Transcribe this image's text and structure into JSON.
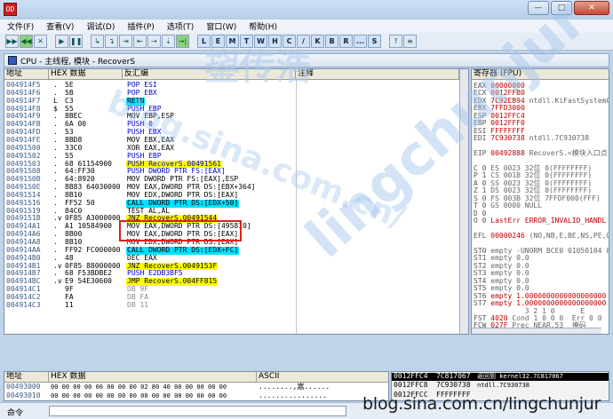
{
  "window": {
    "app_icon": "OD",
    "minimize": "—",
    "maximize": "□",
    "close": "✕"
  },
  "menu": [
    "文件(F)",
    "查看(V)",
    "调试(D)",
    "插件(P)",
    "选项(T)",
    "窗口(W)",
    "帮助(H)"
  ],
  "toolbar": {
    "run_buttons": [
      "▶▶",
      "◀◀",
      "✕",
      "▶",
      "❚❚",
      "↳",
      "↴",
      "⇥",
      "⇤",
      "⇢",
      "⇣",
      "→|"
    ],
    "letters": [
      "L",
      "E",
      "M",
      "T",
      "W",
      "H",
      "C",
      "/",
      "K",
      "B",
      "R",
      "...",
      "S"
    ],
    "extra": [
      "?",
      "≡"
    ]
  },
  "cpu_window": {
    "title": "CPU - 主线程, 模块 - RecoverS"
  },
  "disasm": {
    "headers": {
      "addr": "地址",
      "hex": "HEX 数据",
      "dis": "反汇编",
      "comment": "注释"
    },
    "rows": [
      {
        "addr": "004914F5",
        "mark": ".",
        "hex": "5E",
        "dis": "POP ESI",
        "style": "blue"
      },
      {
        "addr": "004914F6",
        "mark": ".",
        "hex": "5B",
        "dis": "POP EBX",
        "style": "blue"
      },
      {
        "addr": "004914F7",
        "mark": "L",
        "hex": "C3",
        "dis": "RETN",
        "style": "cyan"
      },
      {
        "addr": "004914F8",
        "mark": "$",
        "hex": "55",
        "dis": "PUSH EBP",
        "style": "blue"
      },
      {
        "addr": "004914F9",
        "mark": ".",
        "hex": "8BEC",
        "dis": "MOV EBP,ESP",
        "style": ""
      },
      {
        "addr": "004914FB",
        "mark": ".",
        "hex": "6A 00",
        "dis": "PUSH 0",
        "style": "blue"
      },
      {
        "addr": "004914FD",
        "mark": ".",
        "hex": "53",
        "dis": "PUSH EBX",
        "style": "blue"
      },
      {
        "addr": "004914FE",
        "mark": ".",
        "hex": "8BD8",
        "dis": "MOV EBX,EAX",
        "style": ""
      },
      {
        "addr": "00491500",
        "mark": ".",
        "hex": "33C0",
        "dis": "XOR EAX,EAX",
        "style": ""
      },
      {
        "addr": "00491502",
        "mark": ".",
        "hex": "55",
        "dis": "PUSH EBP",
        "style": "blue"
      },
      {
        "addr": "00491503",
        "mark": ".",
        "hex": "68 61154900",
        "dis": "PUSH RecoverS.00491561",
        "style": "blue-y"
      },
      {
        "addr": "00491508",
        "mark": ".",
        "hex": "64:FF30",
        "dis": "PUSH DWORD PTR FS:[EAX]",
        "style": "blue"
      },
      {
        "addr": "0049150B",
        "mark": ".",
        "hex": "64:8920",
        "dis": "MOV DWORD PTR FS:[EAX],ESP",
        "style": ""
      },
      {
        "addr": "0049150E",
        "mark": ".",
        "hex": "8B83 64030000",
        "dis": "MOV EAX,DWORD PTR DS:[EBX+364]",
        "style": ""
      },
      {
        "addr": "00491514",
        "mark": ".",
        "hex": "8B10",
        "dis": "MOV EDX,DWORD PTR DS:[EAX]",
        "style": ""
      },
      {
        "addr": "00491516",
        "mark": ".",
        "hex": "FF52 50",
        "dis": "CALL DWORD PTR DS:[EDX+50]",
        "style": "cyan"
      },
      {
        "addr": "00491519",
        "mark": ".",
        "hex": "84C0",
        "dis": "TEST AL,AL",
        "style": ""
      },
      {
        "addr": "0049151B",
        "mark": ".v",
        "hex": "0F85 A3000000",
        "dis": "JNZ RecoverS.00491544",
        "style": "yellow"
      },
      {
        "addr": "004914A1",
        "mark": ".",
        "hex": "A1 10584900",
        "dis": "MOV EAX,DWORD PTR DS:[495810]",
        "style": ""
      },
      {
        "addr": "004914A6",
        "mark": ".",
        "hex": "8B00",
        "dis": "MOV EAX,DWORD PTR DS:[EAX]",
        "style": ""
      },
      {
        "addr": "004914A8",
        "mark": ".",
        "hex": "8B10",
        "dis": "MOV EDX,DWORD PTR DS:[EAX]",
        "style": ""
      },
      {
        "addr": "004914AA",
        "mark": ".",
        "hex": "FF92 FC000000",
        "dis": "CALL DWORD PTR DS:[EDX+FC]",
        "style": "cyan"
      },
      {
        "addr": "004914B0",
        "mark": ".",
        "hex": "48",
        "dis": "DEC EAX",
        "style": ""
      },
      {
        "addr": "004914B1",
        "mark": ".v",
        "hex": "0F85 88000000",
        "dis": "JNZ RecoverS.0049153F",
        "style": "yellow"
      },
      {
        "addr": "004914B7",
        "mark": ".",
        "hex": "68 F53BDBE2",
        "dis": "PUSH E2DB3BF5",
        "style": "blue"
      },
      {
        "addr": "004914BC",
        "mark": ".v",
        "hex": "E9 54E30600",
        "dis": "JMP RecoverS.004FF815",
        "style": "yellow"
      },
      {
        "addr": "004914C1",
        "mark": "",
        "hex": "9F",
        "dis": "DB 9F",
        "style": "grey"
      },
      {
        "addr": "004914C2",
        "mark": "",
        "hex": "FA",
        "dis": "DB FA",
        "style": "grey"
      },
      {
        "addr": "004914C3",
        "mark": "",
        "hex": "11",
        "dis": "DB 11",
        "style": "grey"
      }
    ]
  },
  "registers": {
    "header": "寄存器 (FPU)",
    "lines": [
      {
        "name": "EAX",
        "value": "00000000",
        "note": ""
      },
      {
        "name": "ECX",
        "value": "0012FFB0",
        "note": ""
      },
      {
        "name": "EDX",
        "value": "7C92EB94",
        "note": "ntdll.KiFastSystemC"
      },
      {
        "name": "EBX",
        "value": "7FFD3000",
        "note": ""
      },
      {
        "name": "ESP",
        "value": "0012FFC4",
        "note": ""
      },
      {
        "name": "EBP",
        "value": "0012FFF0",
        "note": ""
      },
      {
        "name": "ESI",
        "value": "FFFFFFFF",
        "note": ""
      },
      {
        "name": "EDI",
        "value": "7C930738",
        "note": "ntdll.7C930738"
      },
      {
        "name": "",
        "value": "",
        "note": ""
      },
      {
        "name": "EIP",
        "value": "00492888",
        "note": "RecoverS.<模块入口点"
      },
      {
        "name": "",
        "value": "",
        "note": ""
      },
      {
        "name": "C 0",
        "value": "",
        "note": "ES 0023 32位 0(FFFFFFFF)"
      },
      {
        "name": "P 1",
        "value": "",
        "note": "CS 001B 32位 0(FFFFFFFF)"
      },
      {
        "name": "A 0",
        "value": "",
        "note": "SS 0023 32位 0(FFFFFFFF)"
      },
      {
        "name": "Z 1",
        "value": "",
        "note": "DS 0023 32位 0(FFFFFFFF)"
      },
      {
        "name": "S 0",
        "value": "",
        "note": "FS 003B 32位 7FFDF000(FFF)"
      },
      {
        "name": "T 0",
        "value": "",
        "note": "GS 0000 NULL"
      },
      {
        "name": "D 0",
        "value": "",
        "note": ""
      },
      {
        "name": "O 0",
        "value": "",
        "note": "LastErr ERROR_INVALID_HANDL"
      },
      {
        "name": "",
        "value": "",
        "note": ""
      },
      {
        "name": "EFL",
        "value": "00000246",
        "note": "(NO,NB,E,BE,NS,PE,GE"
      },
      {
        "name": "",
        "value": "",
        "note": ""
      },
      {
        "name": "ST0",
        "value": "",
        "note": "empty -UNORM BCE0 01050104 0"
      },
      {
        "name": "ST1",
        "value": "",
        "note": "empty 0.0"
      },
      {
        "name": "ST2",
        "value": "",
        "note": "empty 0.0"
      },
      {
        "name": "ST3",
        "value": "",
        "note": "empty 0.0"
      },
      {
        "name": "ST4",
        "value": "",
        "note": "empty 0.0"
      },
      {
        "name": "ST5",
        "value": "",
        "note": "empty 0.0"
      },
      {
        "name": "ST6",
        "value": "",
        "note": "empty 1.0000000000000000000"
      },
      {
        "name": "ST7",
        "value": "",
        "note": "empty 1.0000000000000000000"
      },
      {
        "name": "",
        "value": "",
        "note": "            3 2 1 0      E"
      },
      {
        "name": "FST",
        "value": "4020",
        "note": "Cond 1 0 0 0  Err 0 0"
      },
      {
        "name": "FCW",
        "value": "027F",
        "note": "Prec NEAR,53  掩码"
      }
    ]
  },
  "dump": {
    "headers": {
      "addr": "地址",
      "hex": "HEX 数据",
      "ascii": "ASCII"
    },
    "rows": [
      {
        "addr": "00493000",
        "hex": "00 00 00 00 00 00 00 00 02 80 40 00 00 00 00 00",
        "ascii": "........,嵩......"
      },
      {
        "addr": "00493010",
        "hex": "00 00 00 00 00 00 00 00 00 00 00 00 00 00 00 00",
        "ascii": "................"
      }
    ]
  },
  "stack": {
    "rows": [
      {
        "addr": "0012FFC4",
        "value": "7C817067",
        "note": "返回到 kernel32.7C817067"
      },
      {
        "addr": "0012FFC8",
        "value": "7C930738",
        "note": "ntdll.7C930738"
      },
      {
        "addr": "0012FFCC",
        "value": "FFFFFFFF",
        "note": ""
      }
    ]
  },
  "status": {
    "command_label": "命令"
  },
  "watermark": {
    "big": "lingchunjur",
    "cn": "鋆传浩",
    "mid": "blog.sina.com.cn/",
    "url": "blog.sina.com.cn/lingchunjur"
  }
}
